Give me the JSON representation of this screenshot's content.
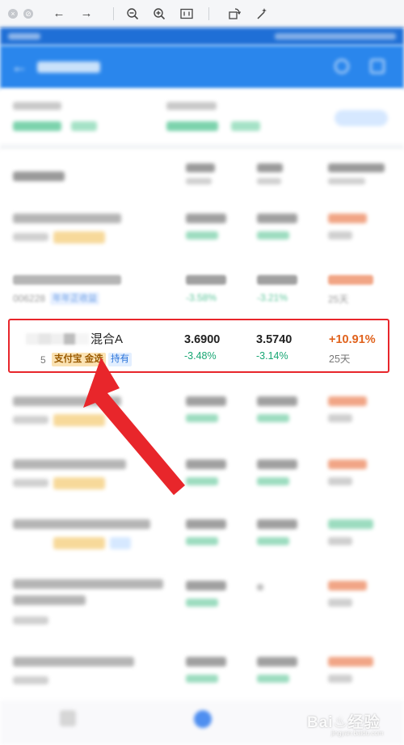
{
  "viewer_toolbar": {
    "icons": [
      "close-icon",
      "stop-icon",
      "arrow-left-icon",
      "arrow-right-icon",
      "zoom-out-icon",
      "zoom-in-icon",
      "fit-icon",
      "rotate-icon",
      "magic-wand-icon"
    ]
  },
  "blurred_row": {
    "code": "006228",
    "tag": "年年正收益",
    "change_a": "-3.58%",
    "change_b": "-3.21%",
    "days": "25天"
  },
  "focus_row": {
    "name_suffix": "混合A",
    "code_partial": "5",
    "tag_platform": "支付宝 金选",
    "tag_hold": "持有",
    "value_a": "3.6900",
    "change_a": "-3.48%",
    "value_b": "3.5740",
    "change_b": "-3.14%",
    "gain": "+10.91%",
    "days": "25天"
  },
  "annotation": {
    "arrow_color": "#e8262b",
    "box_color": "#e8262b"
  },
  "watermark": {
    "text": "Bai♨经验",
    "sub": "jingyan.baidu.com"
  },
  "colors": {
    "primary": "#2a86ec",
    "down": "#17a673",
    "up": "#e0621c"
  }
}
